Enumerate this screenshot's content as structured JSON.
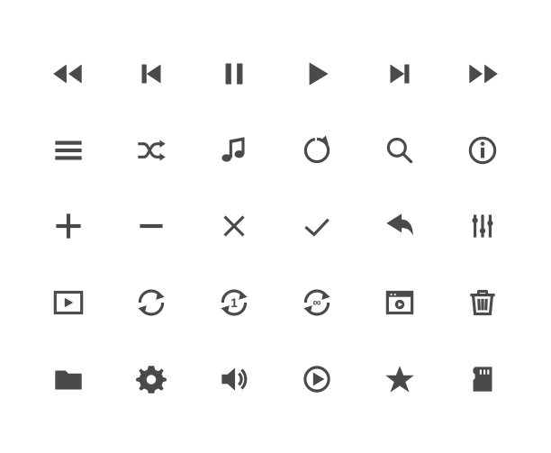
{
  "icons": [
    "rewind",
    "previous",
    "pause",
    "play",
    "next",
    "fast-forward",
    "menu",
    "shuffle",
    "music-note",
    "refresh",
    "search",
    "info",
    "plus",
    "minus",
    "close",
    "check",
    "reply",
    "equalizer",
    "video-playlist",
    "repeat",
    "repeat-one",
    "repeat-infinite",
    "video-player",
    "trash",
    "folder",
    "settings",
    "volume",
    "play-circle",
    "star",
    "sd-card"
  ],
  "color": "#4a4a4a"
}
